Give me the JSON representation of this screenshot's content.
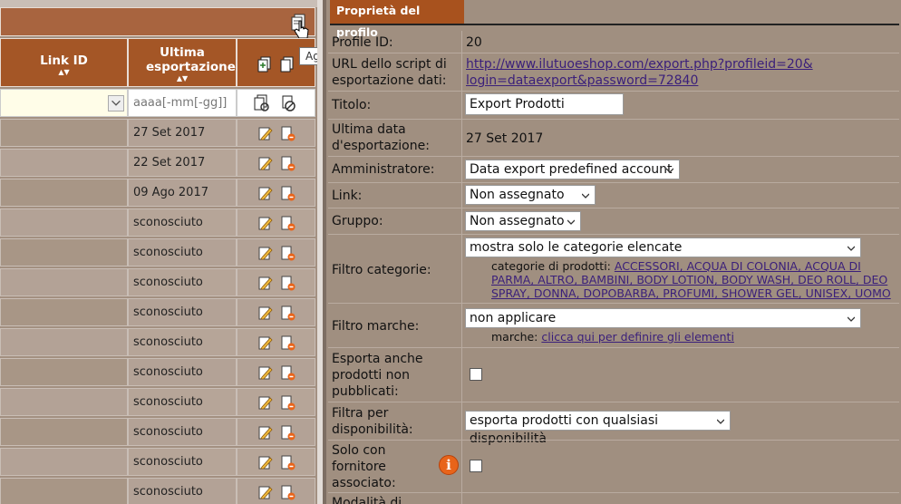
{
  "left_panel": {
    "toolbar": {
      "add_tooltip": "Aggiungi"
    },
    "columns": [
      {
        "label": "Link ID",
        "sort": "▲▼"
      },
      {
        "label": "Ultima esportazione",
        "sort": "▲▼"
      }
    ],
    "filter": {
      "date_placeholder": "aaaa[-mm[-gg]]"
    },
    "rows": [
      {
        "last_export": "27 Set 2017"
      },
      {
        "last_export": "22 Set 2017"
      },
      {
        "last_export": "09 Ago 2017"
      },
      {
        "last_export": "sconosciuto"
      },
      {
        "last_export": "sconosciuto"
      },
      {
        "last_export": "sconosciuto"
      },
      {
        "last_export": "sconosciuto"
      },
      {
        "last_export": "sconosciuto"
      },
      {
        "last_export": "sconosciuto"
      },
      {
        "last_export": "sconosciuto"
      },
      {
        "last_export": "sconosciuto"
      },
      {
        "last_export": "sconosciuto"
      },
      {
        "last_export": "sconosciuto"
      }
    ]
  },
  "right_panel": {
    "tab_label": "Proprietà del profilo",
    "profile_id_label": "Profile ID:",
    "profile_id_value": "20",
    "url_label_1": "URL dello script di",
    "url_label_2": "esportazione dati:",
    "url_line_1": "http://www.ilutuoeshop.com/export.php?profileid=20&",
    "url_line_2": "login=dataexport&password=72840",
    "title_label": "Titolo:",
    "title_value": "Export Prodotti",
    "last_export_label_1": "Ultima data",
    "last_export_label_2": "d'esportazione:",
    "last_export_value": "27 Set 2017",
    "admin_label": "Amministratore:",
    "admin_value": "Data export predefined account",
    "link_label": "Link:",
    "link_value": "Non assegnato",
    "group_label": "Gruppo:",
    "group_value": "Non assegnato",
    "cat_filter_label": "Filtro categorie:",
    "cat_filter_value": "mostra solo le categorie elencate",
    "cat_prefix": "categorie di prodotti:",
    "cat_line_1": "ACCESSORI, ACQUA DI COLONIA, ACQUA DI",
    "cat_line_2": "PARMA, ALTRO, BAMBINI, BODY LOTION, BODY WASH, DEO ROLL, DEO",
    "cat_line_3": "SPRAY, DONNA, DOPOBARBA, PROFUMI, SHOWER GEL, UNISEX, UOMO",
    "brand_filter_label": "Filtro marche:",
    "brand_filter_value": "non applicare",
    "brand_prefix": "marche:",
    "brand_link": "clicca qui per definire gli elementi",
    "unpublished_label_1": "Esporta anche",
    "unpublished_label_2": "prodotti non",
    "unpublished_label_3": "pubblicati:",
    "availability_label_1": "Filtra per",
    "availability_label_2": "disponibilità:",
    "availability_value": "esporta prodotti con qualsiasi disponibilità",
    "supplier_label_1": "Solo con",
    "supplier_label_2": "fornitore",
    "supplier_label_3": "associato:",
    "info_glyph": "i",
    "next_label": "Modalità di"
  },
  "colors": {
    "header_brown": "#a45626",
    "tab_brown": "#a8521e",
    "panel_bg": "#a08f80",
    "link": "#3a1f7a",
    "info_orange": "#e8641a"
  },
  "icons": [
    "add-icon",
    "edit-icon",
    "delete-icon",
    "add-all-icon",
    "filter-apply-icon",
    "filter-clear-icon",
    "info-icon",
    "pointer-cursor-icon"
  ]
}
